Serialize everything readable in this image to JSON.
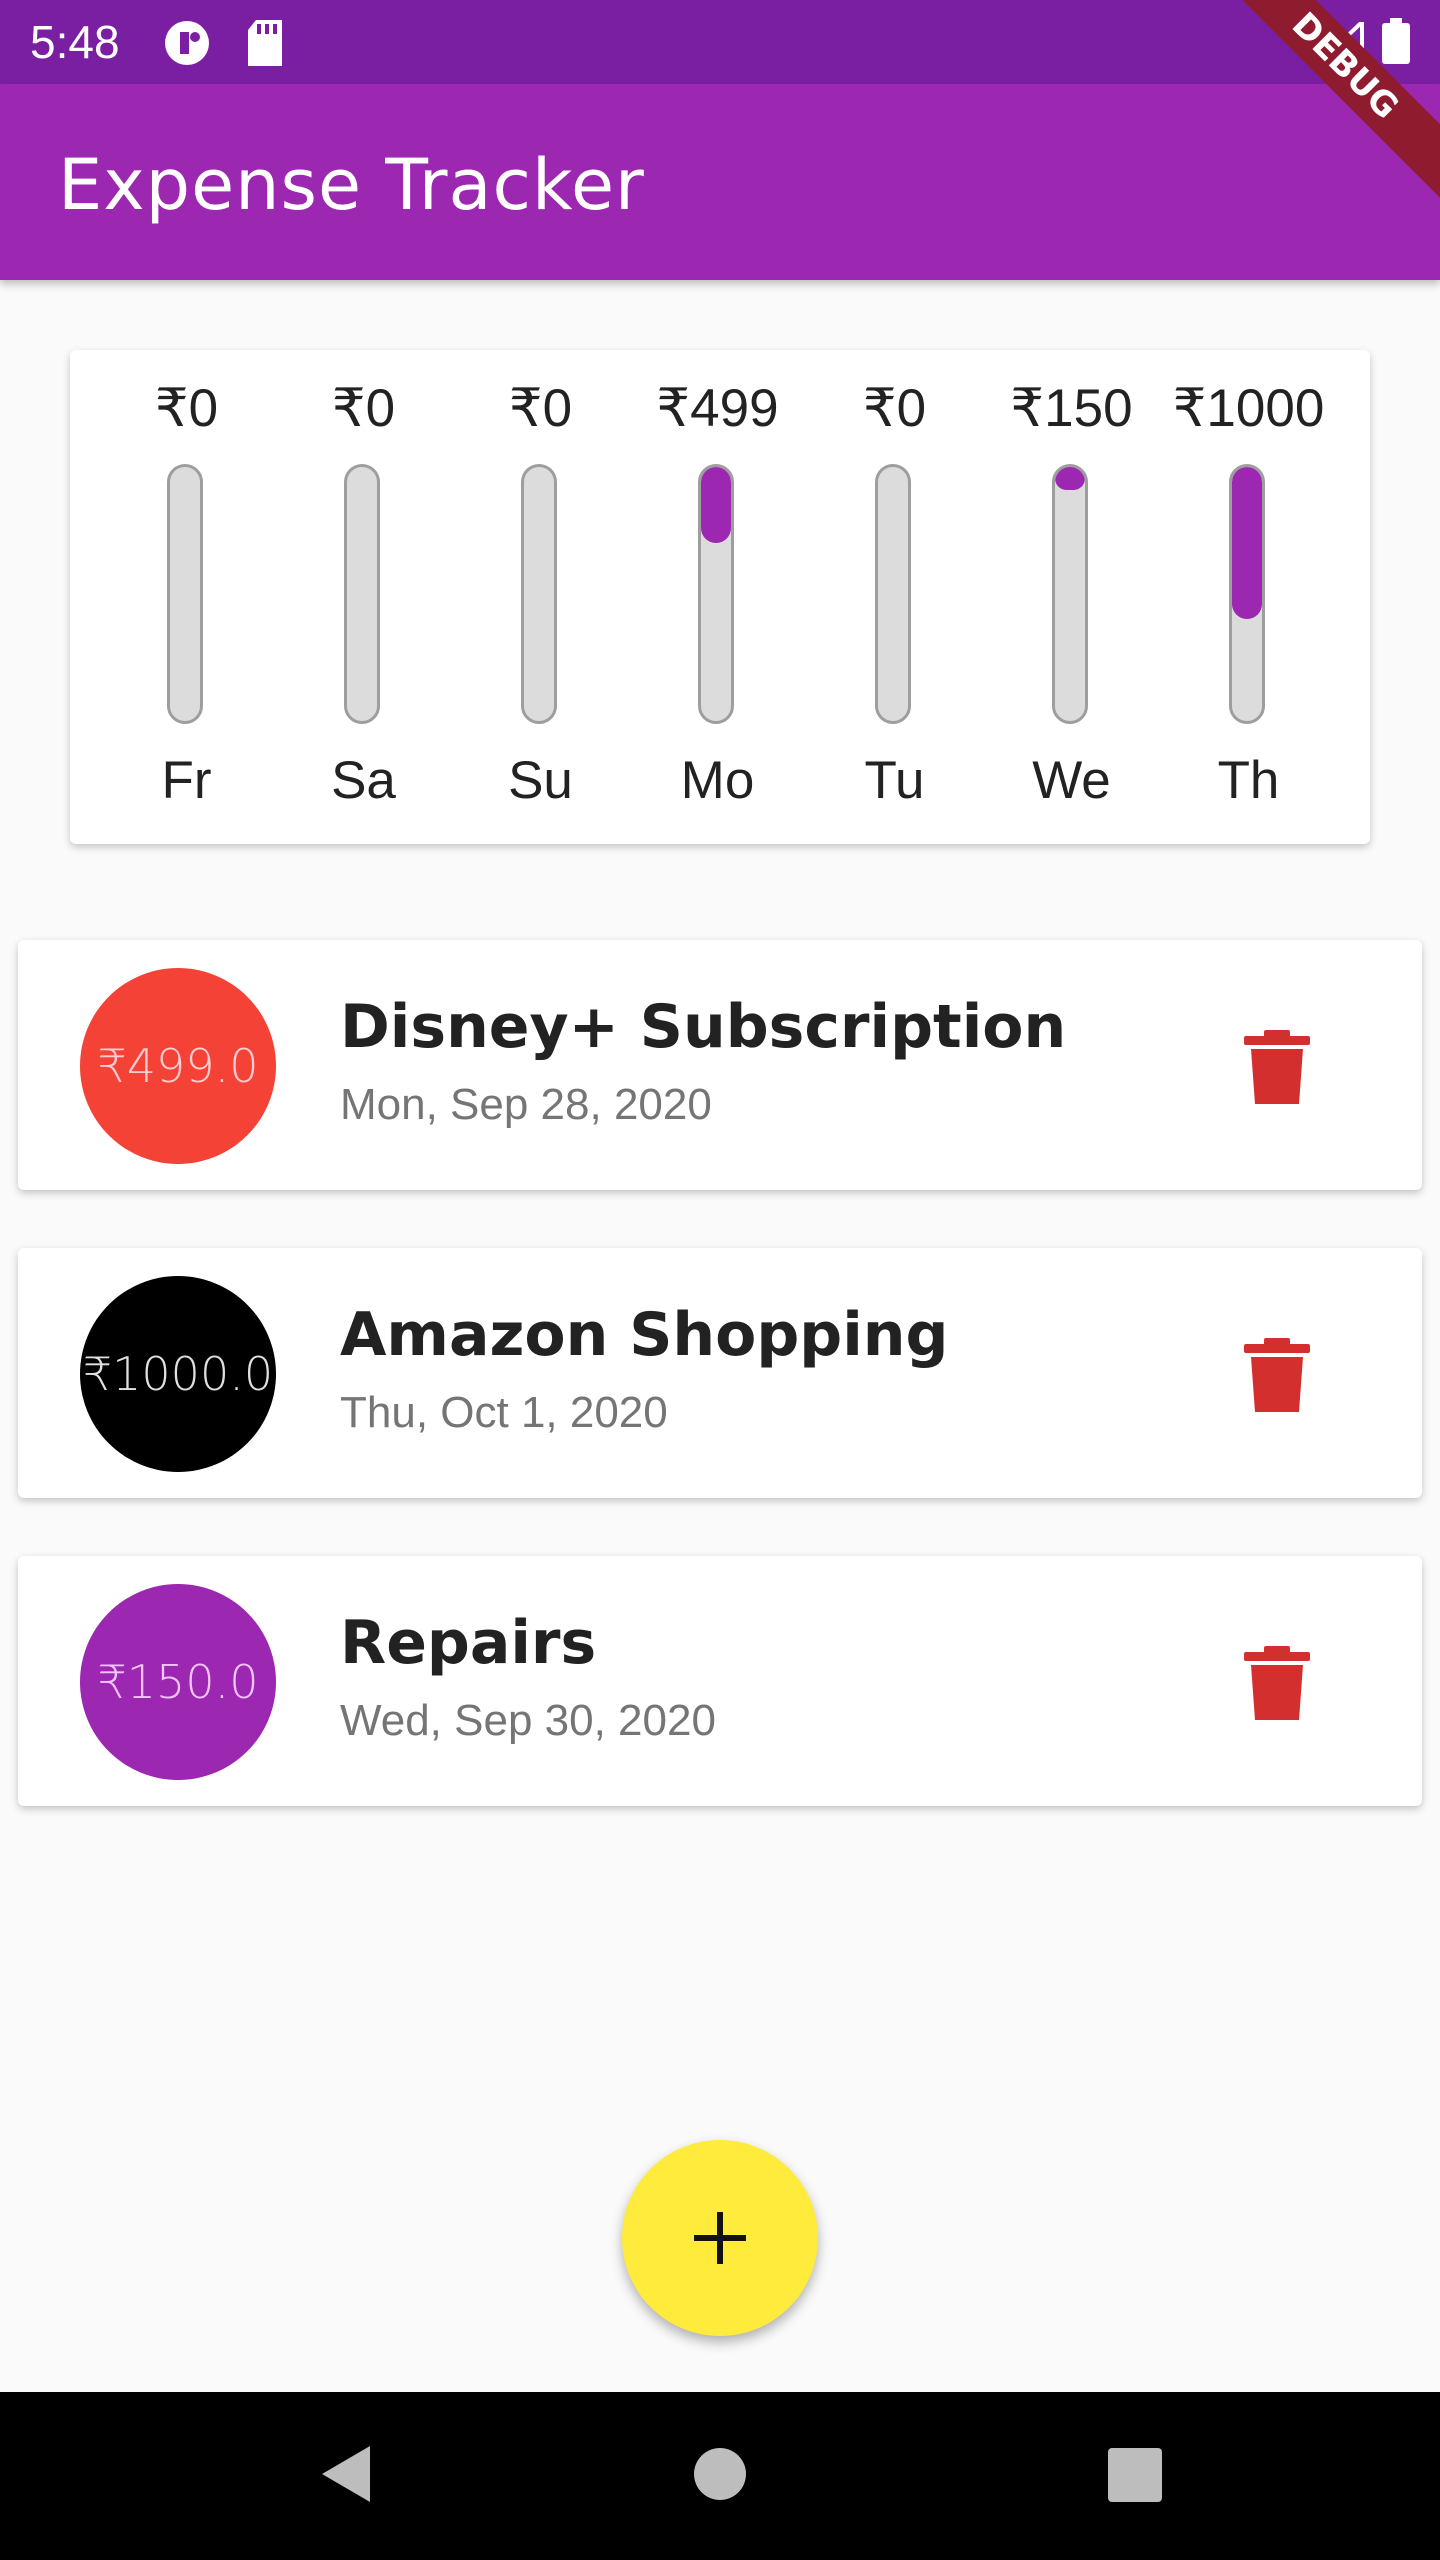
{
  "status_bar": {
    "time": "5:48"
  },
  "app_bar": {
    "title": "Expense Tracker",
    "debug_label": "DEBUG"
  },
  "colors": {
    "primary": "#9c27b0",
    "primary_dark": "#7b1fa2",
    "accent": "#ffeb3b",
    "delete": "#d32f2f"
  },
  "chart_data": {
    "type": "bar",
    "categories": [
      "Fr",
      "Sa",
      "Su",
      "Mo",
      "Tu",
      "We",
      "Th"
    ],
    "labels": [
      "₹0",
      "₹0",
      "₹0",
      "₹499",
      "₹0",
      "₹150",
      "₹1000"
    ],
    "values": [
      0,
      0,
      0,
      499,
      0,
      150,
      1000
    ],
    "fill_fraction": [
      0,
      0,
      0,
      0.3,
      0,
      0.09,
      0.6
    ]
  },
  "transactions": [
    {
      "amount": "₹499.0",
      "title": "Disney+ Subscription",
      "date": "Mon, Sep 28, 2020",
      "avatar_bg": "#f44336",
      "avatar_fg": "#ffcdd2"
    },
    {
      "amount": "₹1000.0",
      "title": "Amazon Shopping",
      "date": "Thu, Oct 1, 2020",
      "avatar_bg": "#000000",
      "avatar_fg": "#e0e0e0"
    },
    {
      "amount": "₹150.0",
      "title": "Repairs",
      "date": "Wed, Sep 30, 2020",
      "avatar_bg": "#9c27b0",
      "avatar_fg": "#f3c4ff"
    }
  ],
  "icons": {
    "delete": "trash-icon",
    "fab": "plus-icon",
    "nav_back": "back-triangle-icon",
    "nav_home": "home-circle-icon",
    "nav_recents": "recents-square-icon"
  }
}
